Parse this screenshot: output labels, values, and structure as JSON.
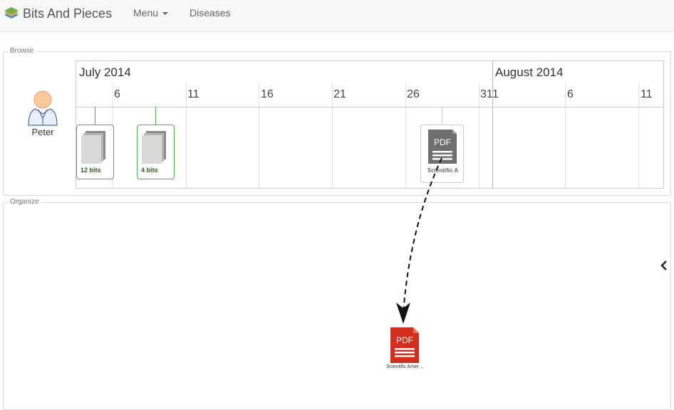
{
  "navbar": {
    "brand": "Bits And Pieces",
    "brand_icon": "layers-logo-icon",
    "menu_label": "Menu",
    "diseases_label": "Diseases"
  },
  "browse": {
    "legend": "Browse",
    "person_icon": "user-avatar-icon",
    "person_name": "Peter",
    "timeline": {
      "months": [
        "July 2014",
        "August 2014"
      ],
      "ticks": [
        "6",
        "11",
        "16",
        "21",
        "26",
        "31",
        "1",
        "6",
        "11"
      ],
      "bundles": [
        {
          "count_label": "12 bits"
        },
        {
          "count_label": "4 bits"
        }
      ],
      "document": {
        "type_label": "PDF",
        "title": "Scientific A"
      }
    }
  },
  "organize": {
    "legend": "Organize",
    "pdf": {
      "type_label": "PDF",
      "caption": "Scientific Amer ..."
    },
    "collapse_icon": "chevron-left-icon"
  },
  "colors": {
    "bundle_border": "#4caf50",
    "pdf_red": "#d32f1f",
    "pdf_grey": "#777777"
  }
}
